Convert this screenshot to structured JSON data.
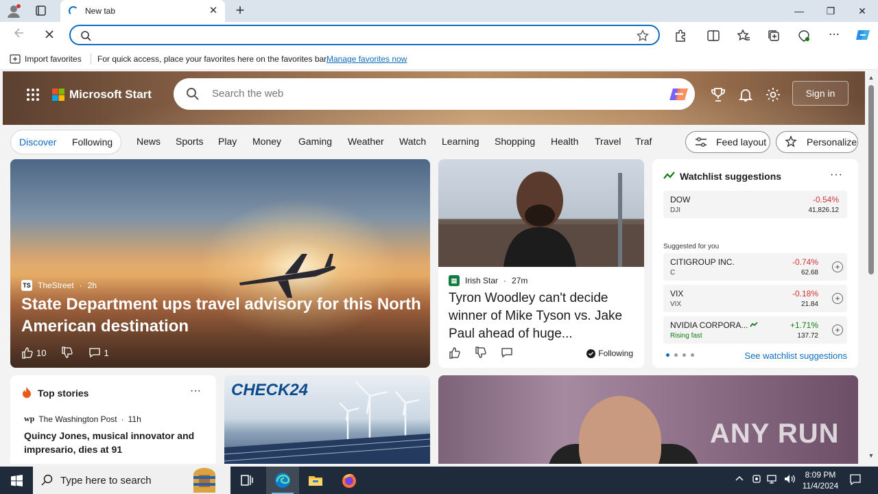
{
  "browser": {
    "tab_title": "New tab",
    "new_tab_symbol": "+",
    "close_tab_symbol": "✕",
    "window_buttons": {
      "minimize": "—",
      "restore": "❐",
      "close": "✕"
    },
    "address_value": "",
    "favorites_bar": {
      "import_label": "Import favorites",
      "message": "For quick access, place your favorites here on the favorites bar.",
      "manage_link": "Manage favorites now"
    }
  },
  "header": {
    "brand": "Microsoft Start",
    "search_placeholder": "Search the web",
    "sign_in": "Sign in"
  },
  "nav": {
    "pills": [
      "Discover",
      "Following"
    ],
    "links": [
      "News",
      "Sports",
      "Play",
      "Money",
      "Gaming",
      "Weather",
      "Watch",
      "Learning",
      "Shopping",
      "Health",
      "Travel",
      "Traf"
    ],
    "feed_layout": "Feed layout",
    "personalize": "Personalize"
  },
  "hero_card": {
    "source": "TheStreet",
    "source_logo": "TS",
    "age": "2h",
    "title": "State Department ups travel advisory for this North American destination",
    "likes": "10",
    "comments": "1"
  },
  "story_card": {
    "source": "Irish Star",
    "age": "27m",
    "title": "Tyron Woodley can't decide winner of Mike Tyson vs. Jake Paul ahead of huge...",
    "following": "Following"
  },
  "watchlist": {
    "title": "Watchlist suggestions",
    "main": {
      "name": "DOW",
      "symbol": "DJI",
      "change": "-0.54%",
      "price": "41,826.12"
    },
    "suggested_label": "Suggested for you",
    "suggestions": [
      {
        "name": "CITIGROUP INC.",
        "symbol": "C",
        "change": "-0.74%",
        "price": "62.68"
      },
      {
        "name": "VIX",
        "symbol": "VIX",
        "change": "-0.18%",
        "price": "21.84"
      },
      {
        "name": "NVIDIA CORPORA...",
        "symbol": "Rising fast",
        "change": "+1.71%",
        "price": "137.72"
      }
    ],
    "see_more": "See watchlist suggestions",
    "colors": {
      "down": "#d13438",
      "up": "#107c10"
    }
  },
  "top_stories": {
    "title": "Top stories",
    "source": "The Washington Post",
    "age": "11h",
    "headline": "Quincy Jones, musical innovator and impresario, dies at 91"
  },
  "ad_card": {
    "logo": "CHECK24"
  },
  "watermark": "ANY RUN",
  "taskbar": {
    "search_placeholder": "Type here to search",
    "time": "8:09 PM",
    "date": "11/4/2024"
  }
}
